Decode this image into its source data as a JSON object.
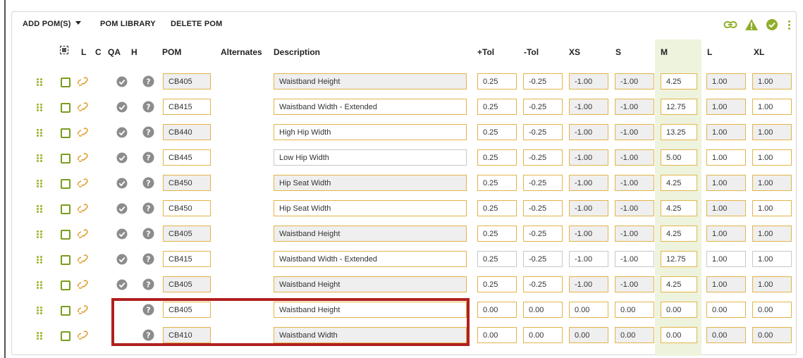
{
  "toolbar": {
    "add_pom": "ADD POM(S)",
    "pom_library": "POM LIBRARY",
    "delete_pom": "DELETE POM",
    "icons": [
      "link-icon",
      "warning-icon",
      "check-circle-icon",
      "kebab-menu-icon"
    ]
  },
  "colors": {
    "accent": "#8fae2a",
    "field_border": "#e3b449",
    "link_icon": "#e0a23a",
    "highlight": "#b0201e",
    "m_column_bg": "#eef3de"
  },
  "headers": {
    "l": "L",
    "c": "C",
    "qa": "QA",
    "h": "H",
    "pom": "POM",
    "alternates": "Alternates",
    "description": "Description",
    "plus_tol": "+Tol",
    "minus_tol": "-Tol",
    "xs": "XS",
    "s": "S",
    "m": "M",
    "l_size": "L",
    "xl": "XL"
  },
  "rows": [
    {
      "qa": true,
      "pom": "CB405",
      "description": "Waistband Height",
      "plus_tol": "0.25",
      "minus_tol": "-0.25",
      "xs": "-1.00",
      "s": "-1.00",
      "m": "4.25",
      "l": "1.00",
      "xl": "1.00"
    },
    {
      "qa": true,
      "pom": "CB415",
      "description": "Waistband Width - Extended",
      "plus_tol": "0.25",
      "minus_tol": "-0.25",
      "xs": "-1.00",
      "s": "-1.00",
      "m": "12.75",
      "l": "1.00",
      "xl": "1.00"
    },
    {
      "qa": true,
      "pom": "CB440",
      "description": "High Hip Width",
      "plus_tol": "0.25",
      "minus_tol": "-0.25",
      "xs": "-1.00",
      "s": "-1.00",
      "m": "13.25",
      "l": "1.00",
      "xl": "1.00"
    },
    {
      "qa": true,
      "pom": "CB445",
      "description": "Low Hip Width",
      "plus_tol": "0.25",
      "minus_tol": "-0.25",
      "xs": "-1.00",
      "s": "-1.00",
      "m": "5.00",
      "l": "1.00",
      "xl": "1.00"
    },
    {
      "qa": true,
      "pom": "CB450",
      "description": "Hip Seat Width",
      "plus_tol": "0.25",
      "minus_tol": "-0.25",
      "xs": "-1.00",
      "s": "-1.00",
      "m": "4.25",
      "l": "1.00",
      "xl": "1.00"
    },
    {
      "qa": true,
      "pom": "CB450",
      "description": "Hip Seat Width",
      "plus_tol": "0.25",
      "minus_tol": "-0.25",
      "xs": "-1.00",
      "s": "-1.00",
      "m": "4.25",
      "l": "1.00",
      "xl": "1.00"
    },
    {
      "qa": true,
      "pom": "CB405",
      "description": "Waistband Height",
      "plus_tol": "0.25",
      "minus_tol": "-0.25",
      "xs": "-1.00",
      "s": "-1.00",
      "m": "4.25",
      "l": "1.00",
      "xl": "1.00"
    },
    {
      "qa": true,
      "pom": "CB415",
      "description": "Waistband Width - Extended",
      "plus_tol": "0.25",
      "minus_tol": "-0.25",
      "xs": "-1.00",
      "s": "-1.00",
      "m": "12.75",
      "l": "1.00",
      "xl": "1.00"
    },
    {
      "qa": true,
      "pom": "CB405",
      "description": "Waistband Height",
      "plus_tol": "0.25",
      "minus_tol": "-0.25",
      "xs": "-1.00",
      "s": "-1.00",
      "m": "4.25",
      "l": "1.00",
      "xl": "1.00"
    },
    {
      "qa": false,
      "pom": "CB405",
      "description": "Waistband Height",
      "plus_tol": "0.00",
      "minus_tol": "0.00",
      "xs": "0.00",
      "s": "0.00",
      "m": "0.00",
      "l": "0.00",
      "xl": "0.00"
    },
    {
      "qa": false,
      "pom": "CB410",
      "description": "Waistband Width",
      "plus_tol": "0.00",
      "minus_tol": "0.00",
      "xs": "0.00",
      "s": "0.00",
      "m": "0.00",
      "l": "0.00",
      "xl": "0.00"
    }
  ]
}
